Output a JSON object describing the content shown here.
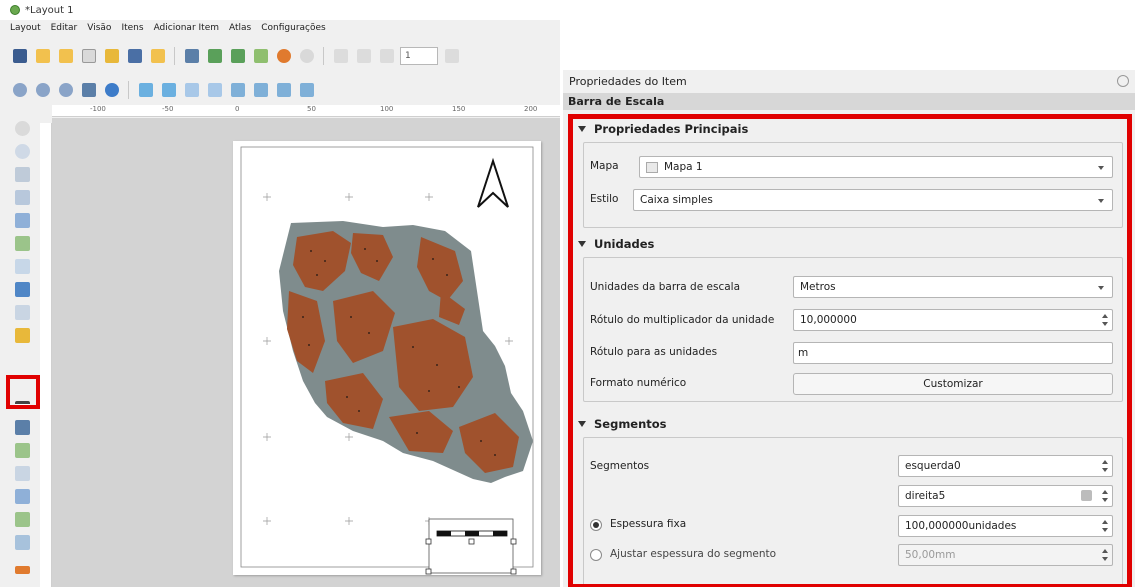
{
  "window": {
    "title": "*Layout 1",
    "menus": [
      "Layout",
      "Editar",
      "Visão",
      "Itens",
      "Adicionar Item",
      "Atlas",
      "Configurações"
    ],
    "page_value": "1"
  },
  "ruler": {
    "ticks": [
      "-100",
      "-50",
      "0",
      "50",
      "100",
      "150",
      "200"
    ]
  },
  "panel": {
    "title": "Propriedades do Item",
    "section": "Barra de Escala",
    "main_props": {
      "header": "Propriedades Principais",
      "map_label": "Mapa",
      "map_value": "Mapa 1",
      "style_label": "Estilo",
      "style_value": "Caixa simples"
    },
    "units": {
      "header": "Unidades",
      "bar_units_label": "Unidades da barra de escala",
      "bar_units_value": "Metros",
      "multiplier_label": "Rótulo do multiplicador da unidade",
      "multiplier_value": "10,000000",
      "unit_label_label": "Rótulo para as unidades",
      "unit_label_value": "m",
      "num_format_label": "Formato numérico",
      "customize_button": "Customizar"
    },
    "segments": {
      "header": "Segmentos",
      "segments_label": "Segmentos",
      "left_value": "esquerda0",
      "right_value": "direita5",
      "fixed_width_label": "Espessura fixa",
      "fixed_width_value": "100,000000unidades",
      "fit_width_label": "Ajustar espessura do segmento",
      "fit_width_value": "50,00mm"
    }
  },
  "colors": {
    "highlight": "#e00000",
    "study_area": "#7f8c8d",
    "patches": "#a0522d"
  }
}
